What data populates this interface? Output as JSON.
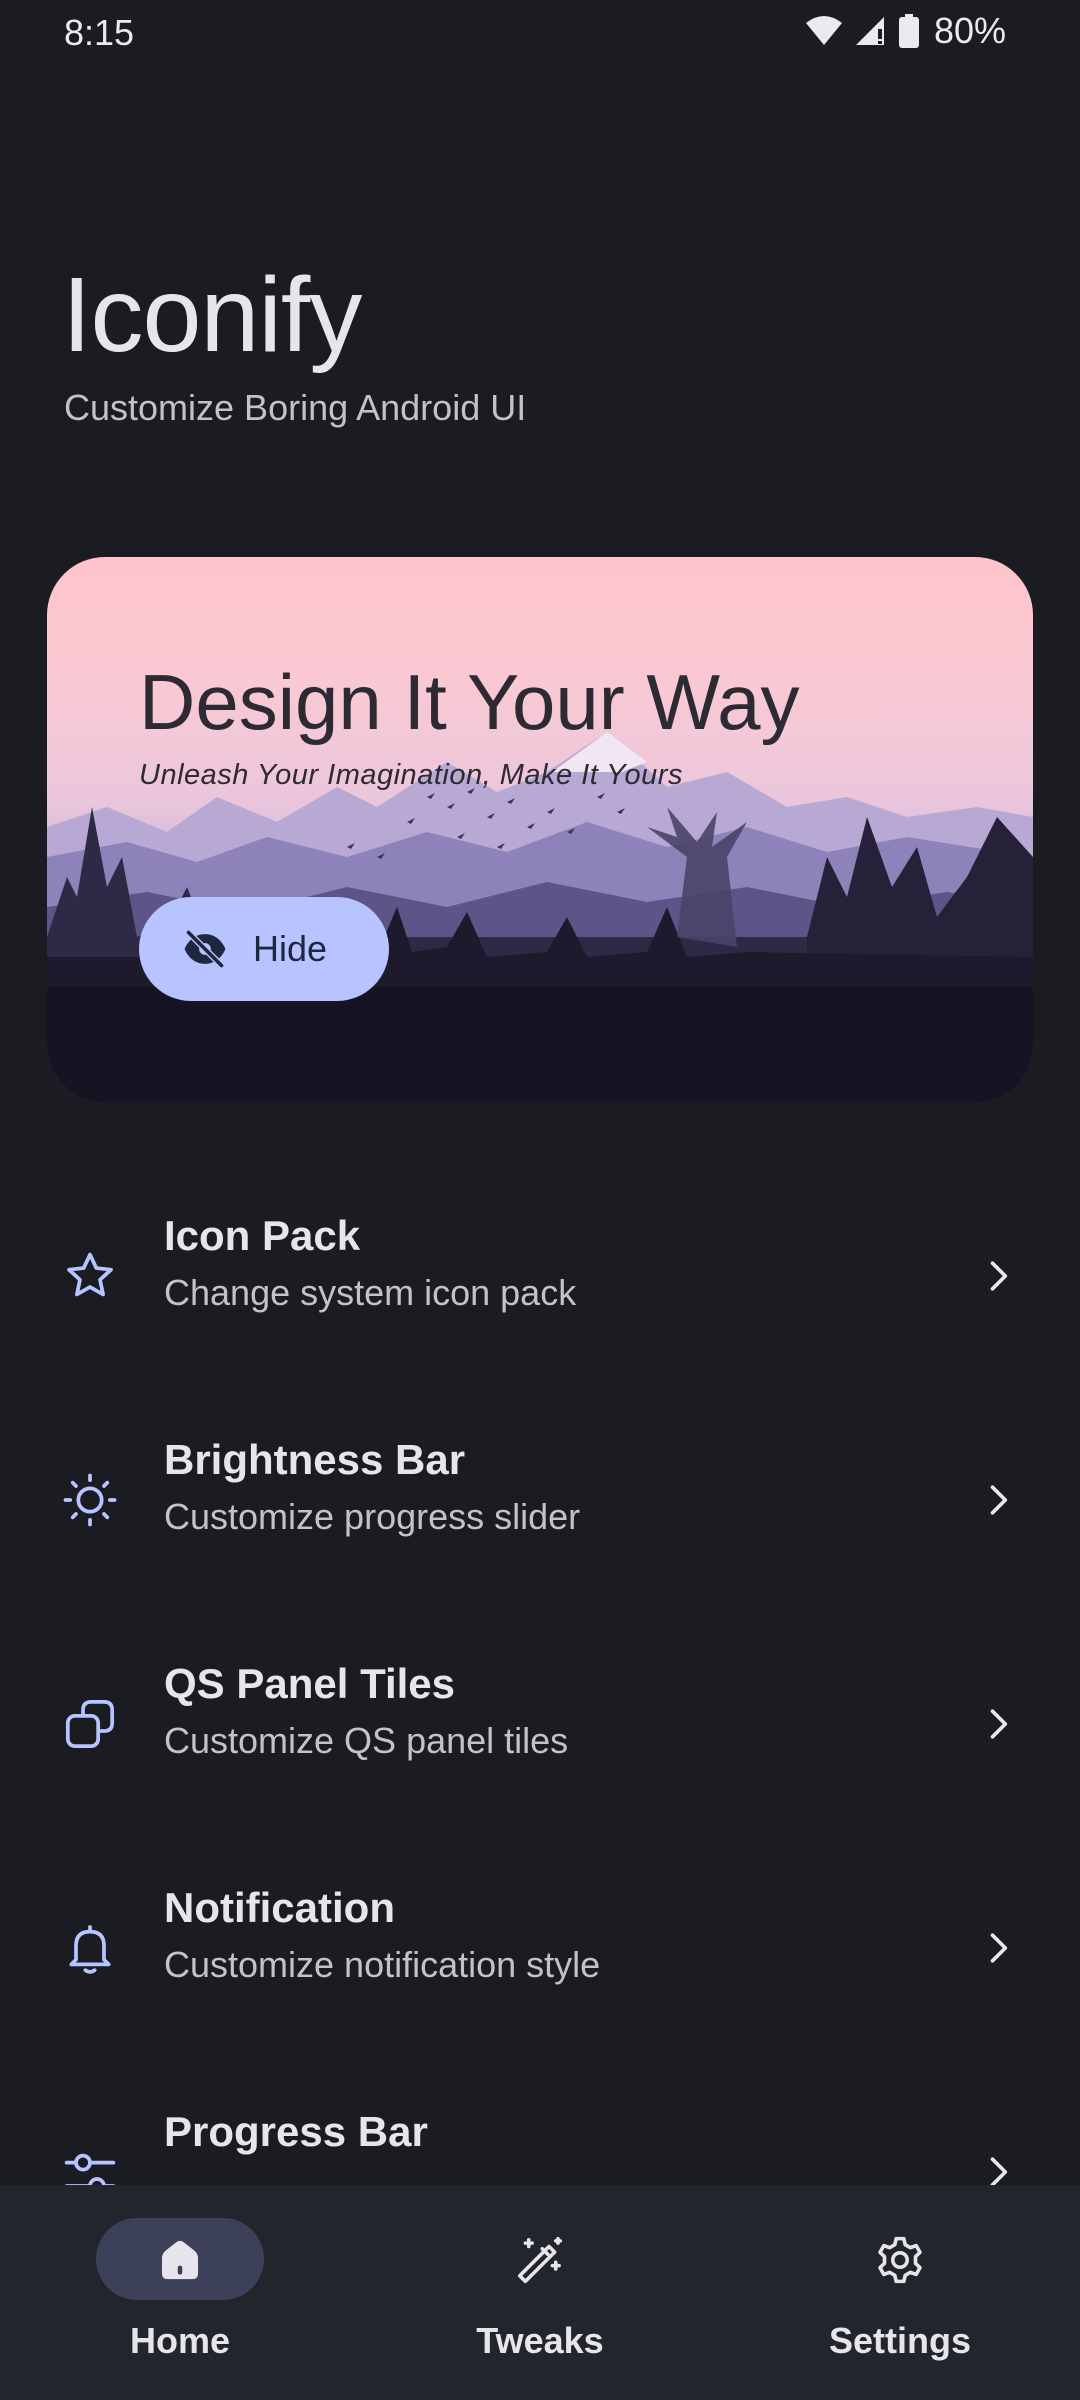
{
  "status_bar": {
    "time": "8:15",
    "battery": "80%",
    "icons": [
      "wifi-icon",
      "signal-icon",
      "battery-icon"
    ]
  },
  "header": {
    "title": "Iconify",
    "subtitle": "Customize Boring Android UI"
  },
  "hero": {
    "title": "Design It Your Way",
    "subtitle": "Unleash Your Imagination, Make It Yours",
    "hide_button_label": "Hide",
    "hide_icon": "eye-off-icon"
  },
  "menu": {
    "items": [
      {
        "title": "Icon Pack",
        "description": "Change system icon pack",
        "icon": "star-icon"
      },
      {
        "title": "Brightness Bar",
        "description": "Customize progress slider",
        "icon": "brightness-icon"
      },
      {
        "title": "QS Panel Tiles",
        "description": "Customize QS panel tiles",
        "icon": "tiles-icon"
      },
      {
        "title": "Notification",
        "description": "Customize notification style",
        "icon": "bell-icon"
      },
      {
        "title": "Progress Bar",
        "description": "",
        "icon": "sliders-icon"
      }
    ]
  },
  "bottom_nav": {
    "items": [
      {
        "label": "Home",
        "icon": "home-icon",
        "active": true
      },
      {
        "label": "Tweaks",
        "icon": "magic-wand-icon",
        "active": false
      },
      {
        "label": "Settings",
        "icon": "gear-icon",
        "active": false
      }
    ]
  },
  "colors": {
    "background": "#1a1c22",
    "accent": "#b8c4ff",
    "nav_background": "#23252d",
    "active_pill": "#3c4058"
  }
}
